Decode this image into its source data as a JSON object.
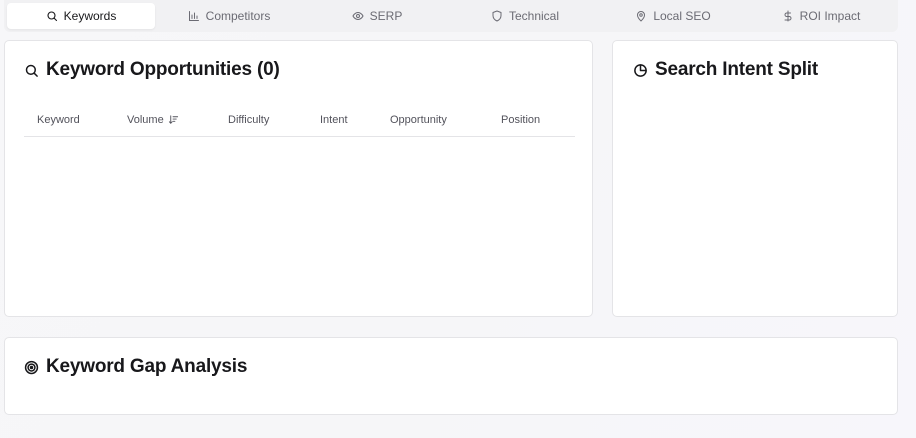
{
  "tabs": [
    {
      "label": "Keywords",
      "icon": "search-icon",
      "active": true
    },
    {
      "label": "Competitors",
      "icon": "bar-chart-icon",
      "active": false
    },
    {
      "label": "SERP",
      "icon": "eye-icon",
      "active": false
    },
    {
      "label": "Technical",
      "icon": "shield-icon",
      "active": false
    },
    {
      "label": "Local SEO",
      "icon": "map-pin-icon",
      "active": false
    },
    {
      "label": "ROI Impact",
      "icon": "dollar-icon",
      "active": false
    }
  ],
  "keywords_card": {
    "title": "Keyword Opportunities (0)",
    "icon": "search-icon",
    "columns": [
      "Keyword",
      "Volume",
      "Difficulty",
      "Intent",
      "Opportunity",
      "Position"
    ],
    "sort_icon": "sort-descending-icon",
    "rows": []
  },
  "intent_card": {
    "title": "Search Intent Split",
    "icon": "pie-chart-icon"
  },
  "gap_card": {
    "title": "Keyword Gap Analysis",
    "icon": "target-icon"
  }
}
